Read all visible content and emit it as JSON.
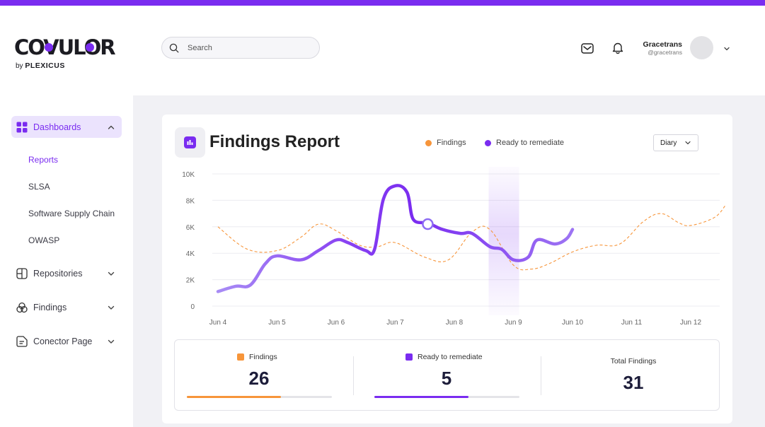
{
  "brand": {
    "name": "COVULOR",
    "sub_prefix": "by",
    "sub_brand": "PLEXICUS"
  },
  "search": {
    "placeholder": "Search"
  },
  "header": {
    "icons": [
      "mail-icon",
      "bell-icon"
    ]
  },
  "user": {
    "name": "Gracetrans",
    "handle": "@gracetrans"
  },
  "sidebar": {
    "dashboards": {
      "label": "Dashboards",
      "icon": "grid-icon",
      "expanded": true
    },
    "sub_items": [
      {
        "label": "Reports",
        "active": true
      },
      {
        "label": "SLSA"
      },
      {
        "label": "Software Supply Chain"
      },
      {
        "label": "OWASP"
      }
    ],
    "repositories": {
      "label": "Repositories",
      "icon": "repository-icon"
    },
    "findings": {
      "label": "Findings",
      "icon": "findings-icon"
    },
    "connector": {
      "label": "Conector Page",
      "icon": "connector-icon"
    }
  },
  "report": {
    "title": "Findings Report",
    "period_select": "Diary",
    "legend": {
      "findings": "Findings",
      "remediate": "Ready to remediate"
    }
  },
  "colors": {
    "accent": "#7a2cf0",
    "findings": "#f7953a",
    "remediate": "#7a2cf0"
  },
  "chart_data": {
    "type": "line",
    "x": [
      "Jun 4",
      "Jun 5",
      "Jun 6",
      "Jun 7",
      "Jun 8",
      "Jun 9",
      "Jun 10",
      "Jun 11",
      "Jun 12"
    ],
    "y_ticks": [
      "0",
      "2K",
      "4K",
      "6K",
      "8K",
      "10K"
    ],
    "ylim": [
      0,
      10000
    ],
    "grid": true,
    "highlight_category": "Jun 9",
    "series": [
      {
        "name": "Findings",
        "style": "dashed",
        "color": "#f7953a",
        "points": [
          [
            0,
            6000
          ],
          [
            0.5,
            4300
          ],
          [
            1,
            4200
          ],
          [
            1.4,
            5200
          ],
          [
            1.7,
            6200
          ],
          [
            2,
            5700
          ],
          [
            2.4,
            4600
          ],
          [
            2.7,
            4500
          ],
          [
            3,
            4800
          ],
          [
            3.5,
            3700
          ],
          [
            3.9,
            3500
          ],
          [
            4.3,
            5600
          ],
          [
            4.6,
            5800
          ],
          [
            5,
            3100
          ],
          [
            5.3,
            2800
          ],
          [
            5.6,
            3200
          ],
          [
            6,
            4100
          ],
          [
            6.4,
            4600
          ],
          [
            6.8,
            4700
          ],
          [
            7.2,
            6400
          ],
          [
            7.5,
            7000
          ],
          [
            7.8,
            6300
          ],
          [
            8,
            6100
          ],
          [
            8.4,
            6700
          ],
          [
            8.6,
            7700
          ]
        ]
      },
      {
        "name": "Ready to remediate",
        "style": "solid",
        "color": "#7a2cf0",
        "points": [
          [
            0,
            1100
          ],
          [
            0.3,
            1500
          ],
          [
            0.55,
            1600
          ],
          [
            0.8,
            3200
          ],
          [
            1,
            3800
          ],
          [
            1.4,
            3500
          ],
          [
            1.7,
            4200
          ],
          [
            2,
            5000
          ],
          [
            2.2,
            4800
          ],
          [
            2.5,
            4200
          ],
          [
            2.65,
            4300
          ],
          [
            2.8,
            8100
          ],
          [
            3,
            9100
          ],
          [
            3.2,
            8600
          ],
          [
            3.3,
            6600
          ],
          [
            3.5,
            6300
          ],
          [
            3.6,
            6200
          ],
          [
            3.8,
            5800
          ],
          [
            4.1,
            5500
          ],
          [
            4.3,
            5500
          ],
          [
            4.6,
            4500
          ],
          [
            4.8,
            4300
          ],
          [
            5,
            3500
          ],
          [
            5.25,
            3700
          ],
          [
            5.4,
            5000
          ],
          [
            5.7,
            4700
          ],
          [
            5.9,
            5100
          ],
          [
            6,
            5800
          ]
        ]
      }
    ],
    "marker": {
      "series": "Ready to remediate",
      "x": 3.55,
      "y": 6200
    }
  },
  "stats": {
    "findings": {
      "label": "Findings",
      "value": "26",
      "progress": 0.65
    },
    "remediate": {
      "label": "Ready to remediate",
      "value": "5",
      "progress": 0.65
    },
    "total": {
      "label": "Total Findings",
      "value": "31"
    }
  }
}
